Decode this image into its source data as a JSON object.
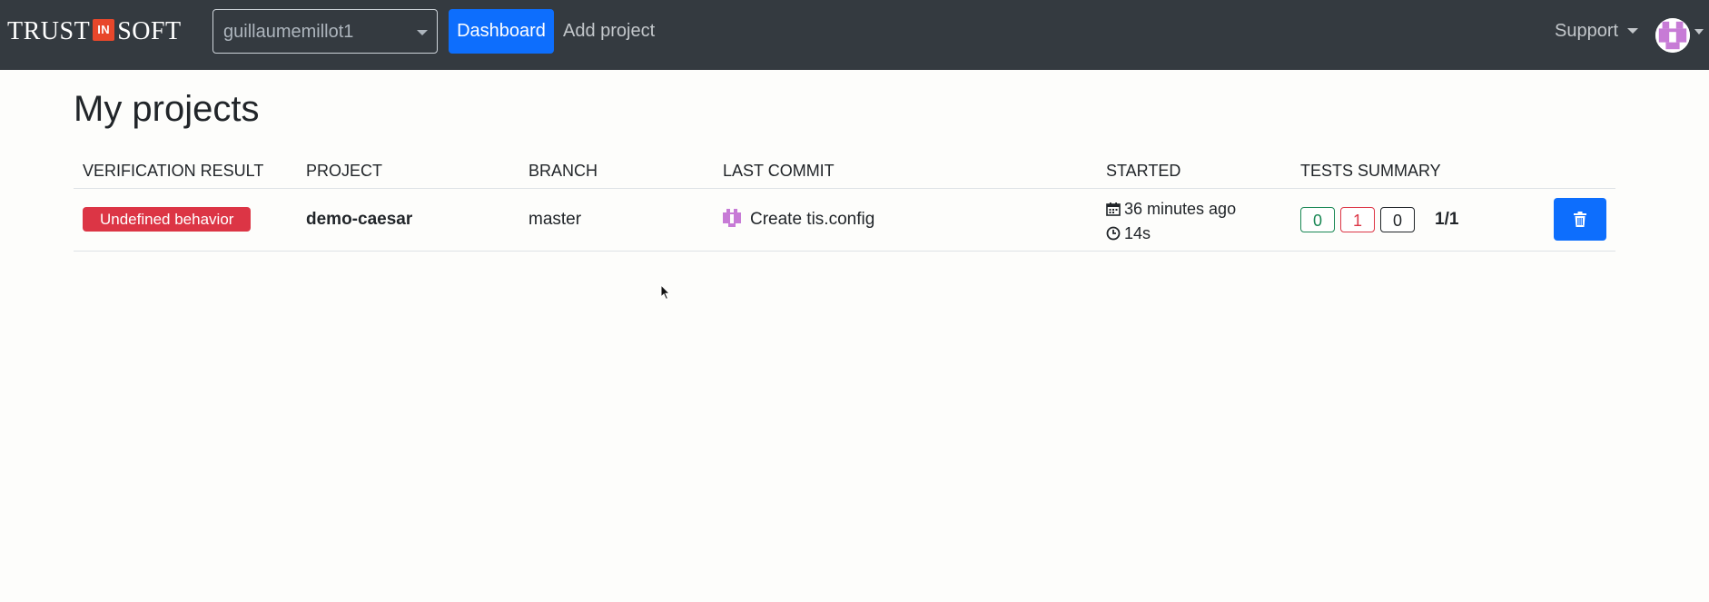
{
  "navbar": {
    "brand_left": "TRUST",
    "brand_mid": "IN",
    "brand_right": "SOFT",
    "org_select_value": "guillaumemillot1",
    "dashboard_label": "Dashboard",
    "add_project_label": "Add project",
    "support_label": "Support"
  },
  "page": {
    "title": "My projects"
  },
  "table": {
    "headers": [
      "VERIFICATION RESULT",
      "PROJECT",
      "BRANCH",
      "LAST COMMIT",
      "STARTED",
      "TESTS SUMMARY"
    ],
    "rows": [
      {
        "verification_result": "Undefined behavior",
        "project": "demo-caesar",
        "branch": "master",
        "last_commit": "Create tis.config",
        "started_ago": "36 minutes ago",
        "duration": "14s",
        "tests_passed": "0",
        "tests_failed": "1",
        "tests_other": "0",
        "tests_ratio": "1/1"
      }
    ]
  },
  "colors": {
    "navbar_bg": "#343a40",
    "primary": "#0d6efd",
    "danger": "#dc3545",
    "success": "#198754",
    "brand_accent": "#e8472b",
    "avatar_purple": "#c77bd6"
  },
  "icons": [
    "caret-down-icon",
    "user-avatar-icon",
    "commit-author-avatar-icon",
    "calendar-icon",
    "clock-icon",
    "trash-icon",
    "mouse-cursor-icon"
  ]
}
